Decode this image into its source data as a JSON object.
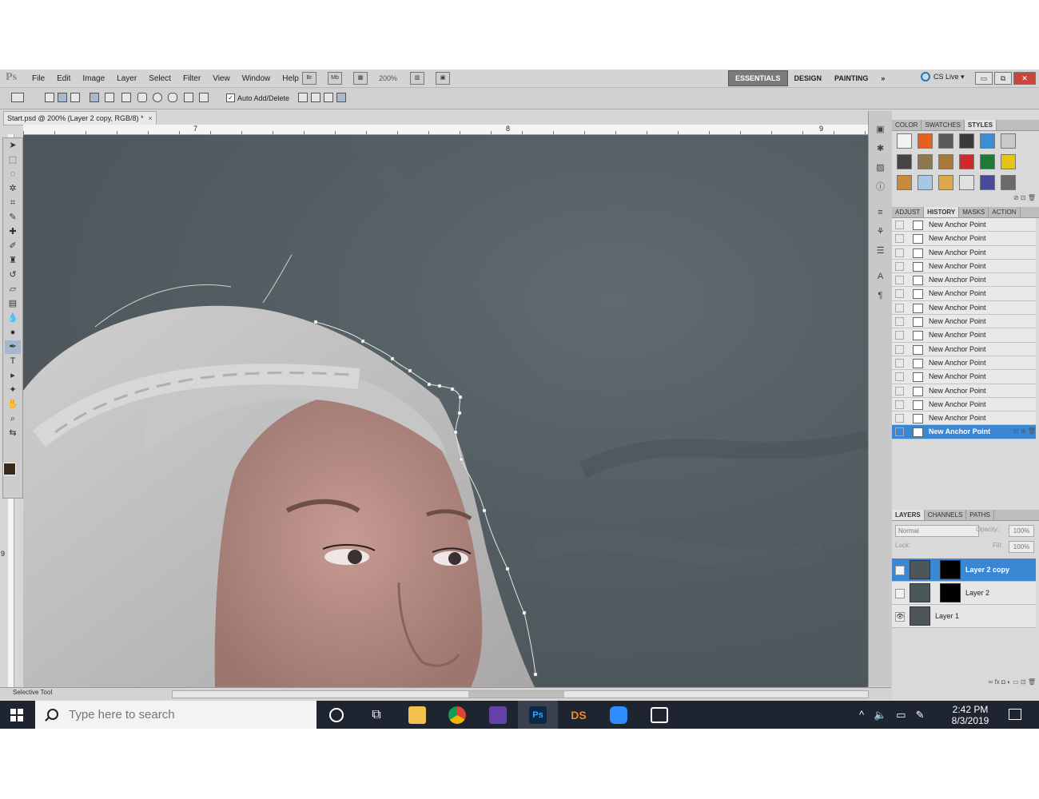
{
  "app": {
    "logo": "Ps",
    "menu": [
      "File",
      "Edit",
      "Image",
      "Layer",
      "Select",
      "Filter",
      "View",
      "Window",
      "Help"
    ],
    "zoom": "200%",
    "workspaces": [
      "ESSENTIALS",
      "DESIGN",
      "PAINTING"
    ],
    "workspace_more": "»",
    "cs_live": "CS Live ▾",
    "window_controls": [
      "▭",
      "⧉",
      "✕"
    ]
  },
  "options_bar": {
    "auto_add_delete_label": "Auto Add/Delete",
    "auto_add_delete_checked": true
  },
  "document": {
    "tab_title": "Start.psd @ 200% (Layer 2 copy, RGB/8) *",
    "tab_close": "×",
    "ruler_numbers": [
      "7",
      "8",
      "9"
    ],
    "vruler_number": "9"
  },
  "status": {
    "text": "Selective Tool"
  },
  "styles_panel": {
    "tabs": [
      "COLOR",
      "SWATCHES",
      "STYLES"
    ],
    "active_tab": "STYLES",
    "swatch_colors": [
      "#f2f2f2",
      "#e8601c",
      "#5a5a5a",
      "#3a3a3a",
      "#3b8ed6",
      "#c9c9c9",
      "#444444",
      "#8c7a4e",
      "#a47a3c",
      "#cc2b2b",
      "#1f7a35",
      "#e3c417",
      "#c88a3a",
      "#a7c7e7",
      "#d9a94a",
      "#e0e0e0",
      "#4a4a9c",
      "#6a6a6a"
    ]
  },
  "history_panel": {
    "tabs": [
      "ADJUST",
      "HISTORY",
      "MASKS",
      "ACTION"
    ],
    "active_tab": "HISTORY",
    "items": [
      "New Anchor Point",
      "New Anchor Point",
      "New Anchor Point",
      "New Anchor Point",
      "New Anchor Point",
      "New Anchor Point",
      "New Anchor Point",
      "New Anchor Point",
      "New Anchor Point",
      "New Anchor Point",
      "New Anchor Point",
      "New Anchor Point",
      "New Anchor Point",
      "New Anchor Point",
      "New Anchor Point",
      "New Anchor Point"
    ],
    "active_index": 15
  },
  "layers_panel": {
    "tabs": [
      "LAYERS",
      "CHANNELS",
      "PATHS"
    ],
    "active_tab": "LAYERS",
    "blend_mode": "Normal",
    "opacity_label": "Opacity:",
    "opacity": "100%",
    "lock_label": "Lock:",
    "fill_label": "Fill:",
    "fill": "100%",
    "layers": [
      {
        "name": "Layer 2 copy",
        "has_mask": true,
        "visible": false,
        "active": true
      },
      {
        "name": "Layer 2",
        "has_mask": true,
        "visible": false,
        "active": false
      },
      {
        "name": "Layer 1",
        "has_mask": false,
        "visible": true,
        "active": false
      }
    ]
  },
  "taskbar": {
    "search_placeholder": "Type here to search",
    "apps": [
      "cortana-icon",
      "task-view-icon",
      "file-explorer-icon",
      "chrome-icon",
      "twitch-icon",
      "photoshop-icon",
      "daz-studio-icon",
      "zoom-icon",
      "photos-icon"
    ],
    "ps_label": "Ps",
    "ds_label": "DS",
    "tray_caret": "^",
    "time": "2:42 PM",
    "date": "8/3/2019"
  }
}
